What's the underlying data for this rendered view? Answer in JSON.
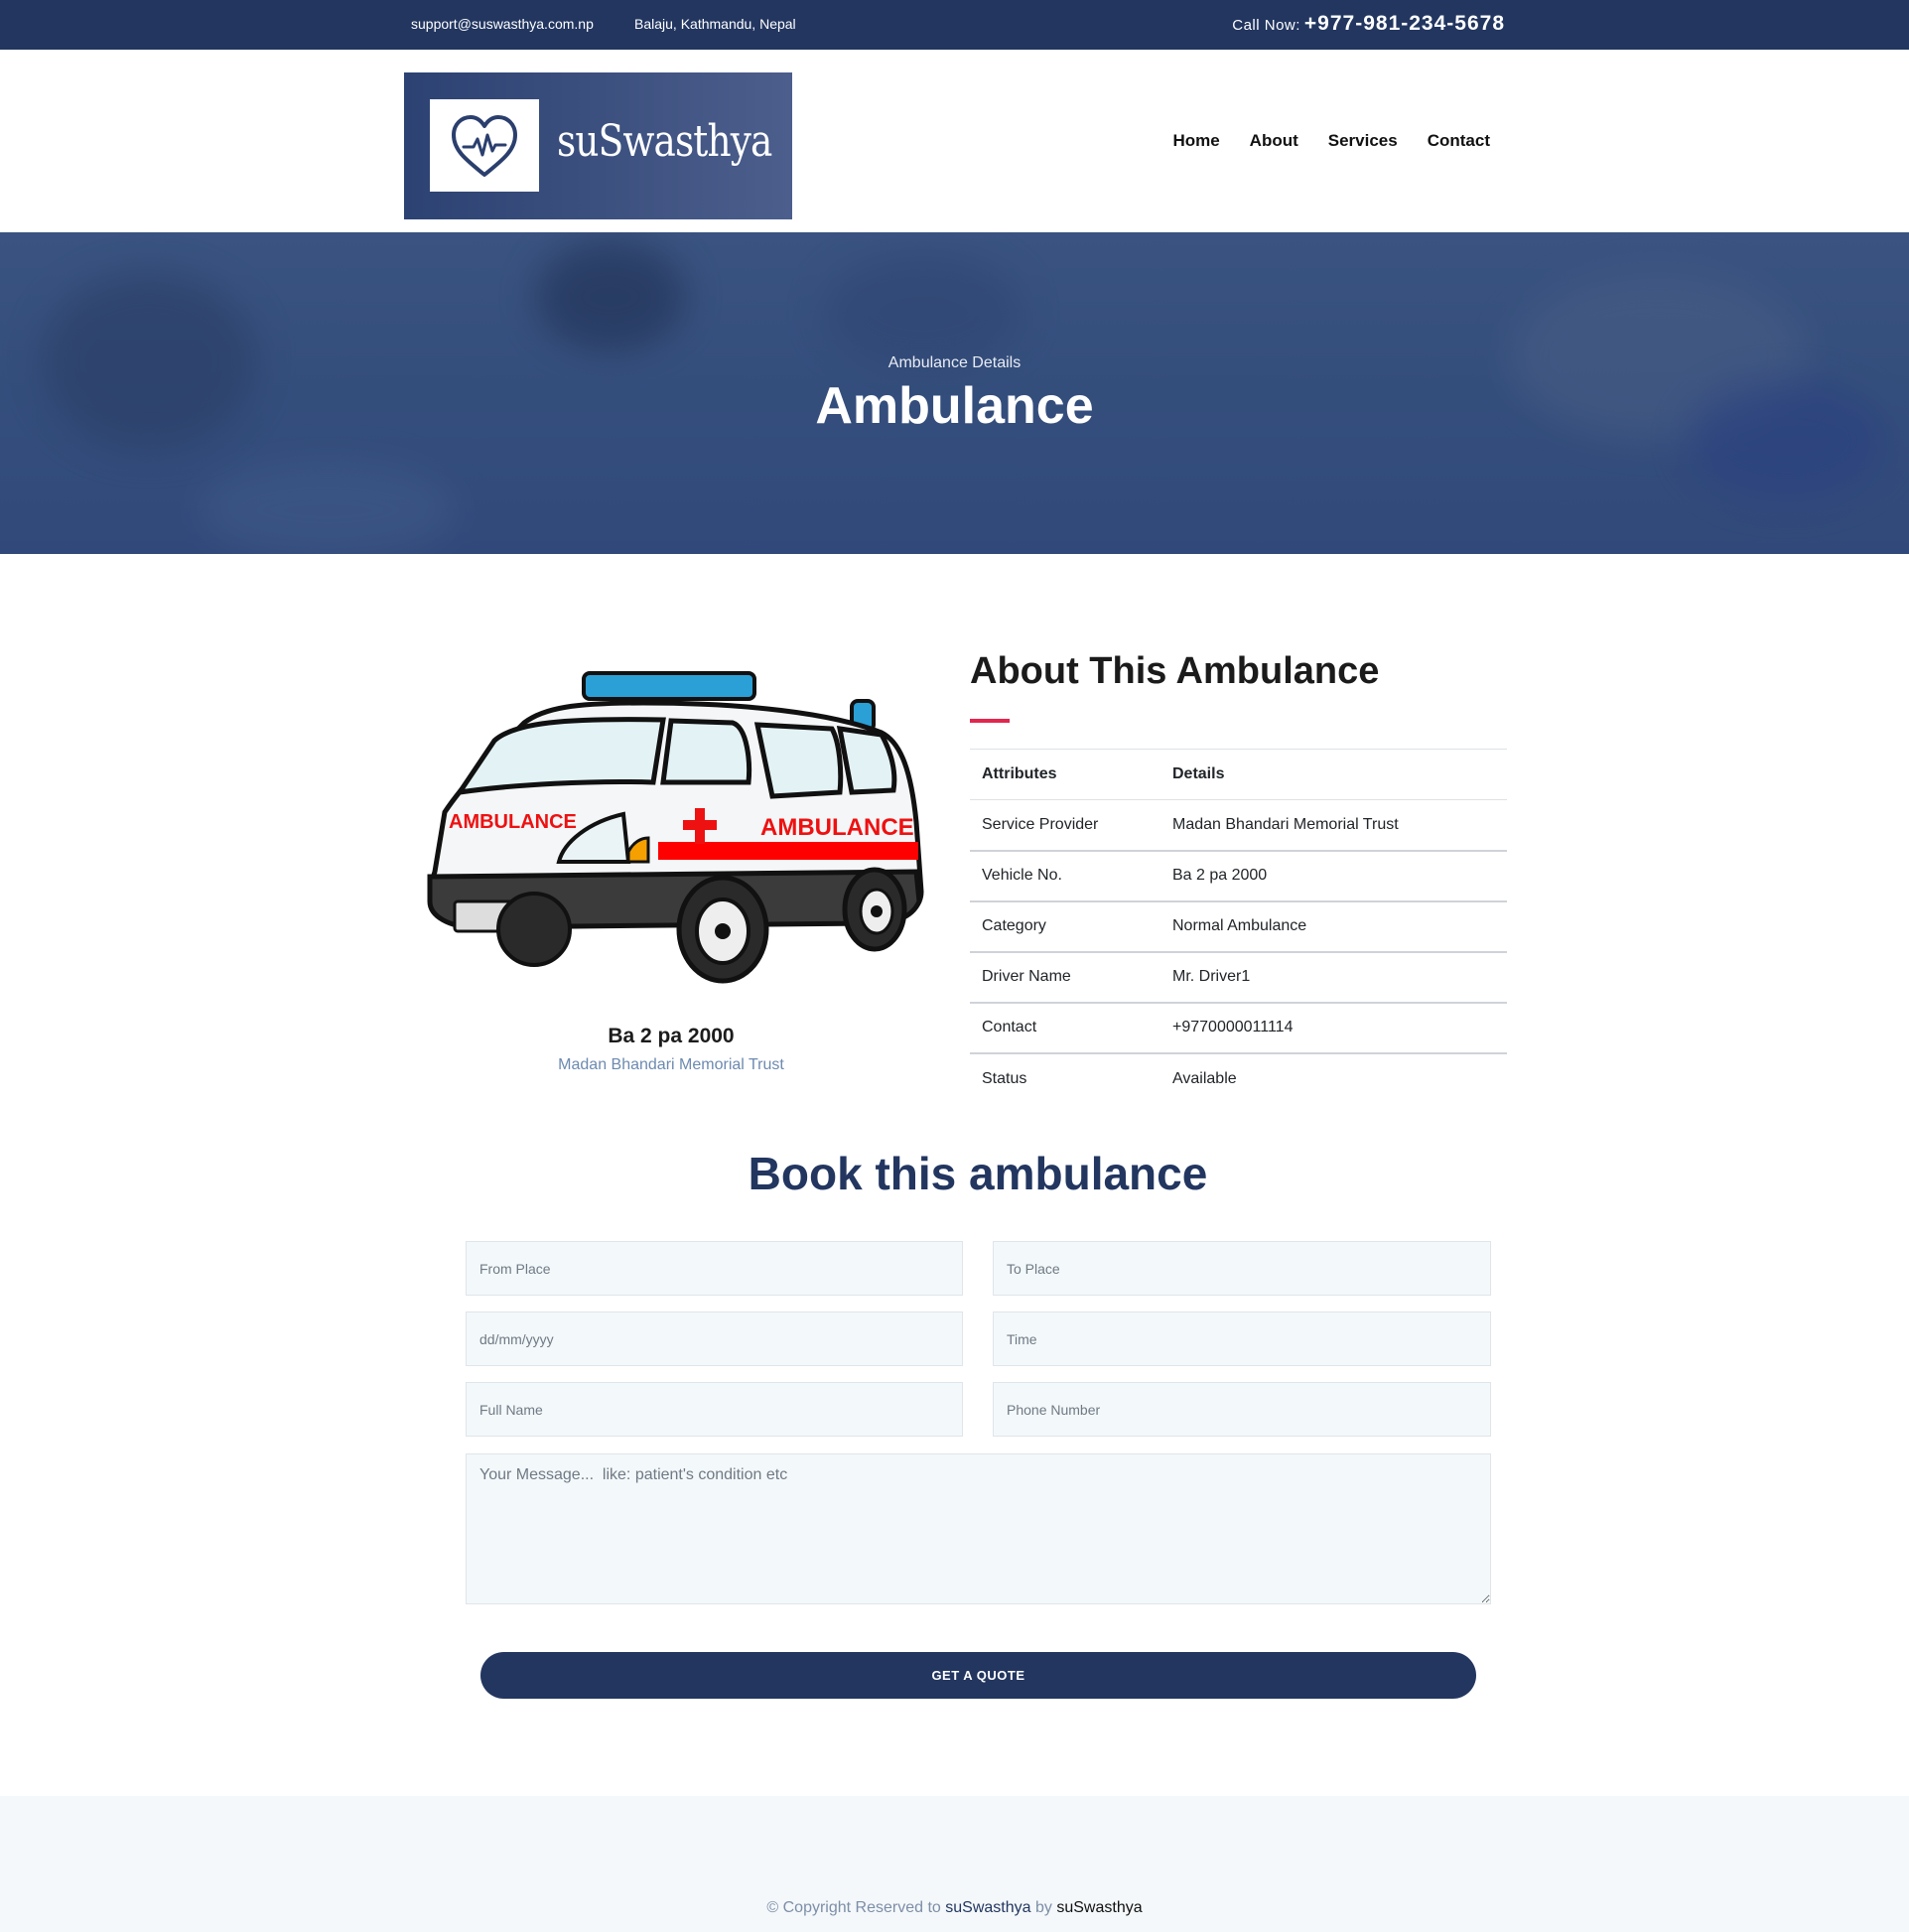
{
  "topbar": {
    "email": "support@suswasthya.com.np",
    "address": "Balaju, Kathmandu, Nepal",
    "call_label": "Call Now:",
    "phone": "+977-981-234-5678"
  },
  "brand": {
    "name": "suSwasthya",
    "logo_icon": "heart-pulse-icon"
  },
  "nav": {
    "home": "Home",
    "about": "About",
    "services": "Services",
    "contact": "Contact"
  },
  "hero": {
    "subtitle": "Ambulance Details",
    "title": "Ambulance"
  },
  "ambulance": {
    "image": "ambulance-illustration",
    "vehicle_no": "Ba 2 pa 2000",
    "provider": "Madan Bhandari Memorial Trust"
  },
  "about": {
    "title": "About This Ambulance",
    "header": {
      "attr": "Attributes",
      "details": "Details"
    },
    "rows": [
      {
        "attr": "Service Provider",
        "value": "Madan Bhandari Memorial Trust"
      },
      {
        "attr": "Vehicle No.",
        "value": "Ba 2 pa 2000"
      },
      {
        "attr": "Category",
        "value": "Normal Ambulance"
      },
      {
        "attr": "Driver Name",
        "value": "Mr. Driver1"
      },
      {
        "attr": "Contact",
        "value": "+9770000011114"
      },
      {
        "attr": "Status",
        "value": "Available"
      }
    ]
  },
  "booking": {
    "title": "Book this ambulance",
    "from_placeholder": "From Place",
    "to_placeholder": "To Place",
    "date_placeholder": "dd/mm/yyyy",
    "time_placeholder": "Time",
    "name_placeholder": "Full Name",
    "phone_placeholder": "Phone Number",
    "message_placeholder": "Your Message...  like: patient's condition etc",
    "button": "GET A QUOTE"
  },
  "footer": {
    "prefix": "© Copyright Reserved to",
    "brand1": "suSwasthya",
    "by": "by",
    "brand2": "suSwasthya"
  },
  "colors": {
    "primary": "#223660",
    "accent": "#e3264e",
    "muted": "#7d8ea8"
  }
}
